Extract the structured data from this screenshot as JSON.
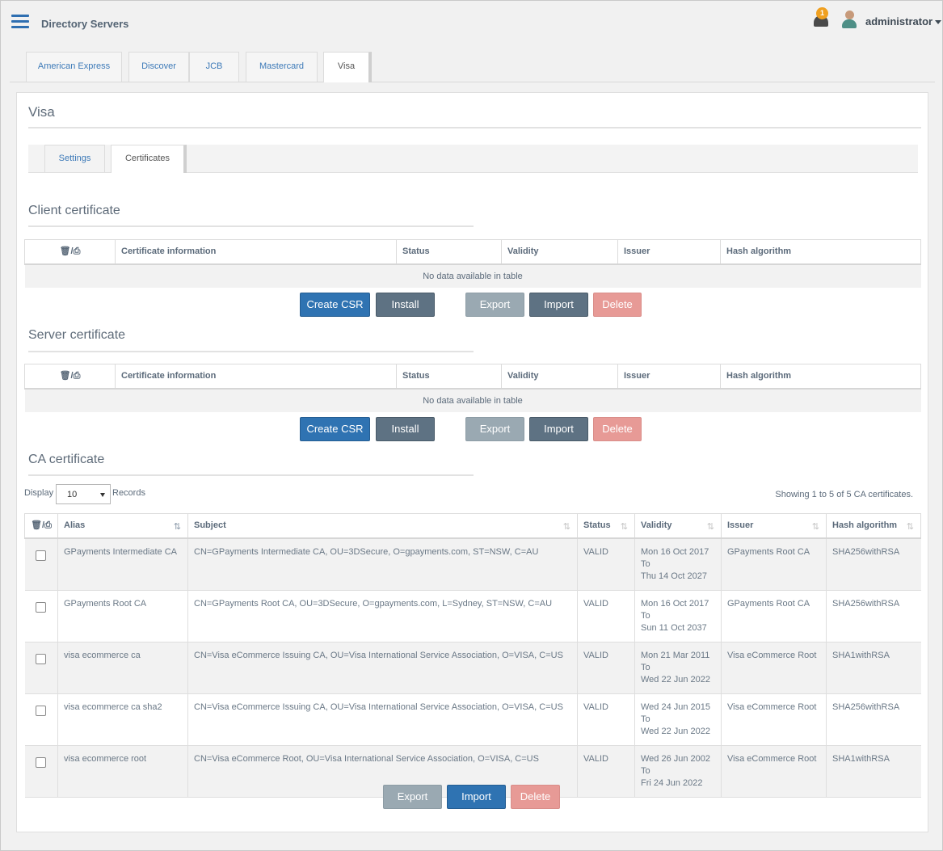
{
  "header": {
    "app_title": "Directory Servers",
    "notification_count": "1",
    "username": "administrator"
  },
  "top_tabs": [
    {
      "label": "American Express"
    },
    {
      "label": "Discover"
    },
    {
      "label": "JCB"
    },
    {
      "label": "Mastercard"
    },
    {
      "label": "Visa",
      "active": true
    }
  ],
  "panel": {
    "title": "Visa",
    "sub_tabs": [
      {
        "label": "Settings"
      },
      {
        "label": "Certificates",
        "active": true
      }
    ]
  },
  "cert_table_headers": {
    "icons": "🗑/⎙",
    "info": "Certificate information",
    "status": "Status",
    "validity": "Validity",
    "issuer": "Issuer",
    "hash": "Hash algorithm"
  },
  "client_certificate": {
    "title": "Client certificate",
    "empty_message": "No data available in table",
    "buttons": {
      "create_csr": "Create CSR",
      "install": "Install",
      "export": "Export",
      "import": "Import",
      "delete": "Delete"
    }
  },
  "server_certificate": {
    "title": "Server certificate",
    "empty_message": "No data available in table",
    "buttons": {
      "create_csr": "Create CSR",
      "install": "Install",
      "export": "Export",
      "import": "Import",
      "delete": "Delete"
    }
  },
  "ca_certificate": {
    "title": "CA certificate",
    "display_label": "Display",
    "records_label": "Records",
    "page_size": "10",
    "showing_text": "Showing 1 to 5 of 5 CA certificates.",
    "headers": {
      "icons": "🗑/⎙",
      "alias": "Alias",
      "subject": "Subject",
      "status": "Status",
      "validity": "Validity",
      "issuer": "Issuer",
      "hash": "Hash algorithm"
    },
    "rows": [
      {
        "alias": "GPayments Intermediate CA",
        "subject": "CN=GPayments Intermediate CA, OU=3DSecure, O=gpayments.com, ST=NSW, C=AU",
        "status": "VALID",
        "valid_from": "Mon 16 Oct 2017",
        "to": "To",
        "valid_to": "Thu 14 Oct 2027",
        "issuer": "GPayments Root CA",
        "hash": "SHA256withRSA"
      },
      {
        "alias": "GPayments Root CA",
        "subject": "CN=GPayments Root CA, OU=3DSecure, O=gpayments.com, L=Sydney, ST=NSW, C=AU",
        "status": "VALID",
        "valid_from": "Mon 16 Oct 2017",
        "to": "To",
        "valid_to": "Sun 11 Oct 2037",
        "issuer": "GPayments Root CA",
        "hash": "SHA256withRSA"
      },
      {
        "alias": "visa ecommerce ca",
        "subject": "CN=Visa eCommerce Issuing CA, OU=Visa International Service Association, O=VISA, C=US",
        "status": "VALID",
        "valid_from": "Mon 21 Mar 2011",
        "to": "To",
        "valid_to": "Wed 22 Jun 2022",
        "issuer": "Visa eCommerce Root",
        "hash": "SHA1withRSA"
      },
      {
        "alias": "visa ecommerce ca sha2",
        "subject": "CN=Visa eCommerce Issuing CA, OU=Visa International Service Association, O=VISA, C=US",
        "status": "VALID",
        "valid_from": "Wed 24 Jun 2015",
        "to": "To",
        "valid_to": "Wed 22 Jun 2022",
        "issuer": "Visa eCommerce Root",
        "hash": "SHA256withRSA"
      },
      {
        "alias": "visa ecommerce root",
        "subject": "CN=Visa eCommerce Root, OU=Visa International Service Association, O=VISA, C=US",
        "status": "VALID",
        "valid_from": "Wed 26 Jun 2002",
        "to": "To",
        "valid_to": "Fri 24 Jun 2022",
        "issuer": "Visa eCommerce Root",
        "hash": "SHA1withRSA"
      }
    ],
    "buttons": {
      "export": "Export",
      "import": "Import",
      "delete": "Delete"
    }
  },
  "icons": {
    "menu": "hamburger-icon",
    "notification": "bell-icon",
    "user": "user-avatar-icon",
    "sort": "sort-icon",
    "sort_active": "sort-alpha-asc-icon"
  },
  "colors": {
    "primary": "#2f73b2",
    "slate": "#5e7283",
    "disabled": "#9aa9b2",
    "danger": "#e79a96",
    "badge": "#f0a020"
  }
}
